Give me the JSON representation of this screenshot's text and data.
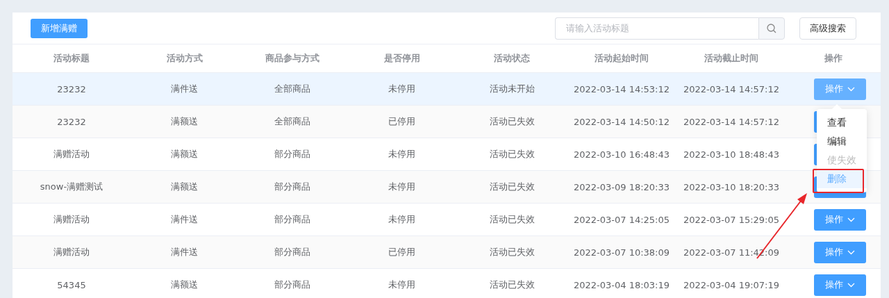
{
  "toolbar": {
    "add_button": "新增满赠",
    "search": {
      "placeholder": "请输入活动标题"
    },
    "advanced_search_button": "高级搜索"
  },
  "table": {
    "columns": [
      "活动标题",
      "活动方式",
      "商品参与方式",
      "是否停用",
      "活动状态",
      "活动起始时间",
      "活动截止时间",
      "操作"
    ],
    "rows": [
      {
        "cells": [
          "23232",
          "满件送",
          "全部商品",
          "未停用",
          "活动未开始",
          "2022-03-14 14:53:12",
          "2022-03-14 14:57:12"
        ],
        "action": "操作",
        "highlighted": true
      },
      {
        "cells": [
          "23232",
          "满额送",
          "全部商品",
          "已停用",
          "活动已失效",
          "2022-03-14 14:50:12",
          "2022-03-14 14:57:12"
        ],
        "highlighted": false
      },
      {
        "cells": [
          "满赠活动",
          "满额送",
          "部分商品",
          "未停用",
          "活动已失效",
          "2022-03-10 16:48:43",
          "2022-03-10 18:48:43"
        ],
        "highlighted": false
      },
      {
        "cells": [
          "snow-满赠测试",
          "满额送",
          "部分商品",
          "未停用",
          "活动已失效",
          "2022-03-09 18:20:33",
          "2022-03-10 18:20:33"
        ],
        "highlighted": false
      },
      {
        "cells": [
          "满赠活动",
          "满件送",
          "部分商品",
          "未停用",
          "活动已失效",
          "2022-03-07 14:25:05",
          "2022-03-07 15:29:05"
        ],
        "action": "操作",
        "highlighted": false
      },
      {
        "cells": [
          "满赠活动",
          "满件送",
          "部分商品",
          "已停用",
          "活动已失效",
          "2022-03-07 10:38:09",
          "2022-03-07 11:42:09"
        ],
        "action": "操作",
        "highlighted": false
      },
      {
        "cells": [
          "54345",
          "满额送",
          "部分商品",
          "未停用",
          "活动已失效",
          "2022-03-04 18:03:19",
          "2022-03-04 19:07:19"
        ],
        "action": "操作",
        "highlighted": false
      }
    ]
  },
  "dropdown_menu": {
    "items": [
      {
        "label": "查看",
        "disabled": false,
        "hovered": false
      },
      {
        "label": "编辑",
        "disabled": false,
        "hovered": false
      },
      {
        "label": "使失效",
        "disabled": true,
        "hovered": false
      },
      {
        "label": "删除",
        "disabled": false,
        "hovered": true
      }
    ]
  }
}
